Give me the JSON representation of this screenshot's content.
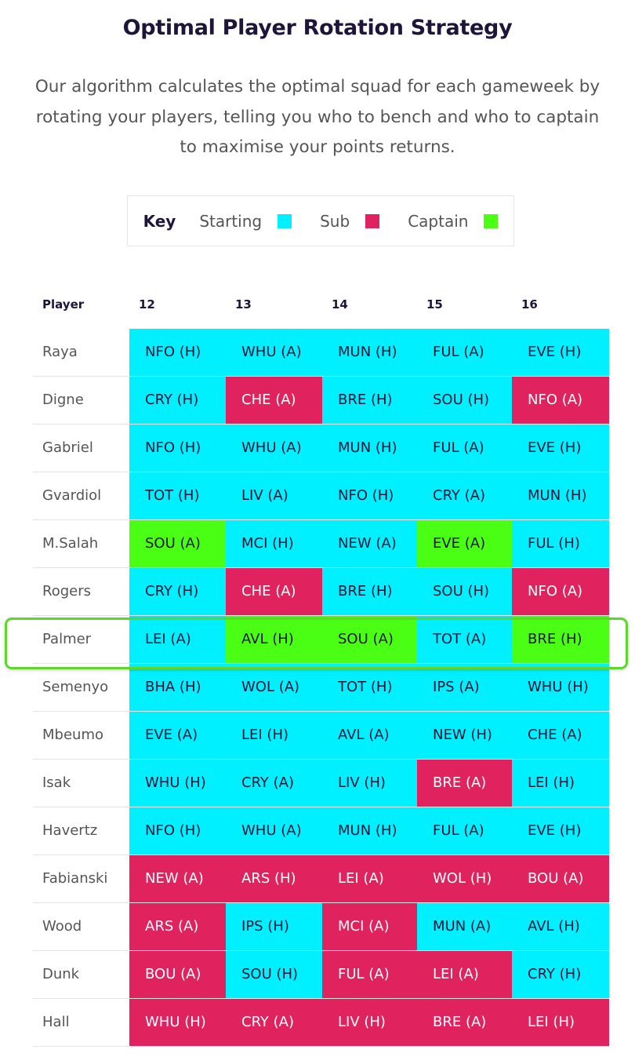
{
  "title": "Optimal Player Rotation Strategy",
  "description": "Our algorithm calculates the optimal squad for each gameweek by rotating your players, telling you who to bench and who to captain to maximise your points returns.",
  "key": {
    "label": "Key",
    "items": [
      {
        "label": "Starting",
        "color": "#00f0ff"
      },
      {
        "label": "Sub",
        "color": "#e0225e"
      },
      {
        "label": "Captain",
        "color": "#4aff14"
      }
    ]
  },
  "colors": {
    "starting": "#00f0ff",
    "sub": "#e0225e",
    "captain": "#4aff14",
    "highlight": "#5fd62a"
  },
  "table": {
    "header": {
      "player": "Player",
      "gameweeks": [
        "12",
        "13",
        "14",
        "15",
        "16"
      ]
    },
    "highlighted_player": "Palmer",
    "rows": [
      {
        "player": "Raya",
        "cells": [
          [
            "NFO (H)",
            "starting"
          ],
          [
            "WHU (A)",
            "starting"
          ],
          [
            "MUN (H)",
            "starting"
          ],
          [
            "FUL (A)",
            "starting"
          ],
          [
            "EVE (H)",
            "starting"
          ]
        ]
      },
      {
        "player": "Digne",
        "cells": [
          [
            "CRY (H)",
            "starting"
          ],
          [
            "CHE (A)",
            "sub"
          ],
          [
            "BRE (H)",
            "starting"
          ],
          [
            "SOU (H)",
            "starting"
          ],
          [
            "NFO (A)",
            "sub"
          ]
        ]
      },
      {
        "player": "Gabriel",
        "cells": [
          [
            "NFO (H)",
            "starting"
          ],
          [
            "WHU (A)",
            "starting"
          ],
          [
            "MUN (H)",
            "starting"
          ],
          [
            "FUL (A)",
            "starting"
          ],
          [
            "EVE (H)",
            "starting"
          ]
        ]
      },
      {
        "player": "Gvardiol",
        "cells": [
          [
            "TOT (H)",
            "starting"
          ],
          [
            "LIV (A)",
            "starting"
          ],
          [
            "NFO (H)",
            "starting"
          ],
          [
            "CRY (A)",
            "starting"
          ],
          [
            "MUN (H)",
            "starting"
          ]
        ]
      },
      {
        "player": "M.Salah",
        "cells": [
          [
            "SOU (A)",
            "captain"
          ],
          [
            "MCI (H)",
            "starting"
          ],
          [
            "NEW (A)",
            "starting"
          ],
          [
            "EVE (A)",
            "captain"
          ],
          [
            "FUL (H)",
            "starting"
          ]
        ]
      },
      {
        "player": "Rogers",
        "cells": [
          [
            "CRY (H)",
            "starting"
          ],
          [
            "CHE (A)",
            "sub"
          ],
          [
            "BRE (H)",
            "starting"
          ],
          [
            "SOU (H)",
            "starting"
          ],
          [
            "NFO (A)",
            "sub"
          ]
        ]
      },
      {
        "player": "Palmer",
        "cells": [
          [
            "LEI (A)",
            "starting"
          ],
          [
            "AVL (H)",
            "captain"
          ],
          [
            "SOU (A)",
            "captain"
          ],
          [
            "TOT (A)",
            "starting"
          ],
          [
            "BRE (H)",
            "captain"
          ]
        ]
      },
      {
        "player": "Semenyo",
        "cells": [
          [
            "BHA (H)",
            "starting"
          ],
          [
            "WOL (A)",
            "starting"
          ],
          [
            "TOT (H)",
            "starting"
          ],
          [
            "IPS (A)",
            "starting"
          ],
          [
            "WHU (H)",
            "starting"
          ]
        ]
      },
      {
        "player": "Mbeumo",
        "cells": [
          [
            "EVE (A)",
            "starting"
          ],
          [
            "LEI (H)",
            "starting"
          ],
          [
            "AVL (A)",
            "starting"
          ],
          [
            "NEW (H)",
            "starting"
          ],
          [
            "CHE (A)",
            "starting"
          ]
        ]
      },
      {
        "player": "Isak",
        "cells": [
          [
            "WHU (H)",
            "starting"
          ],
          [
            "CRY (A)",
            "starting"
          ],
          [
            "LIV (H)",
            "starting"
          ],
          [
            "BRE (A)",
            "sub"
          ],
          [
            "LEI (H)",
            "starting"
          ]
        ]
      },
      {
        "player": "Havertz",
        "cells": [
          [
            "NFO (H)",
            "starting"
          ],
          [
            "WHU (A)",
            "starting"
          ],
          [
            "MUN (H)",
            "starting"
          ],
          [
            "FUL (A)",
            "starting"
          ],
          [
            "EVE (H)",
            "starting"
          ]
        ]
      },
      {
        "player": "Fabianski",
        "cells": [
          [
            "NEW (A)",
            "sub"
          ],
          [
            "ARS (H)",
            "sub"
          ],
          [
            "LEI (A)",
            "sub"
          ],
          [
            "WOL (H)",
            "sub"
          ],
          [
            "BOU (A)",
            "sub"
          ]
        ]
      },
      {
        "player": "Wood",
        "cells": [
          [
            "ARS (A)",
            "sub"
          ],
          [
            "IPS (H)",
            "starting"
          ],
          [
            "MCI (A)",
            "sub"
          ],
          [
            "MUN (A)",
            "starting"
          ],
          [
            "AVL (H)",
            "starting"
          ]
        ]
      },
      {
        "player": "Dunk",
        "cells": [
          [
            "BOU (A)",
            "sub"
          ],
          [
            "SOU (H)",
            "starting"
          ],
          [
            "FUL (A)",
            "sub"
          ],
          [
            "LEI (A)",
            "sub"
          ],
          [
            "CRY (H)",
            "starting"
          ]
        ]
      },
      {
        "player": "Hall",
        "cells": [
          [
            "WHU (H)",
            "sub"
          ],
          [
            "CRY (A)",
            "sub"
          ],
          [
            "LIV (H)",
            "sub"
          ],
          [
            "BRE (A)",
            "sub"
          ],
          [
            "LEI (H)",
            "sub"
          ]
        ]
      }
    ]
  }
}
